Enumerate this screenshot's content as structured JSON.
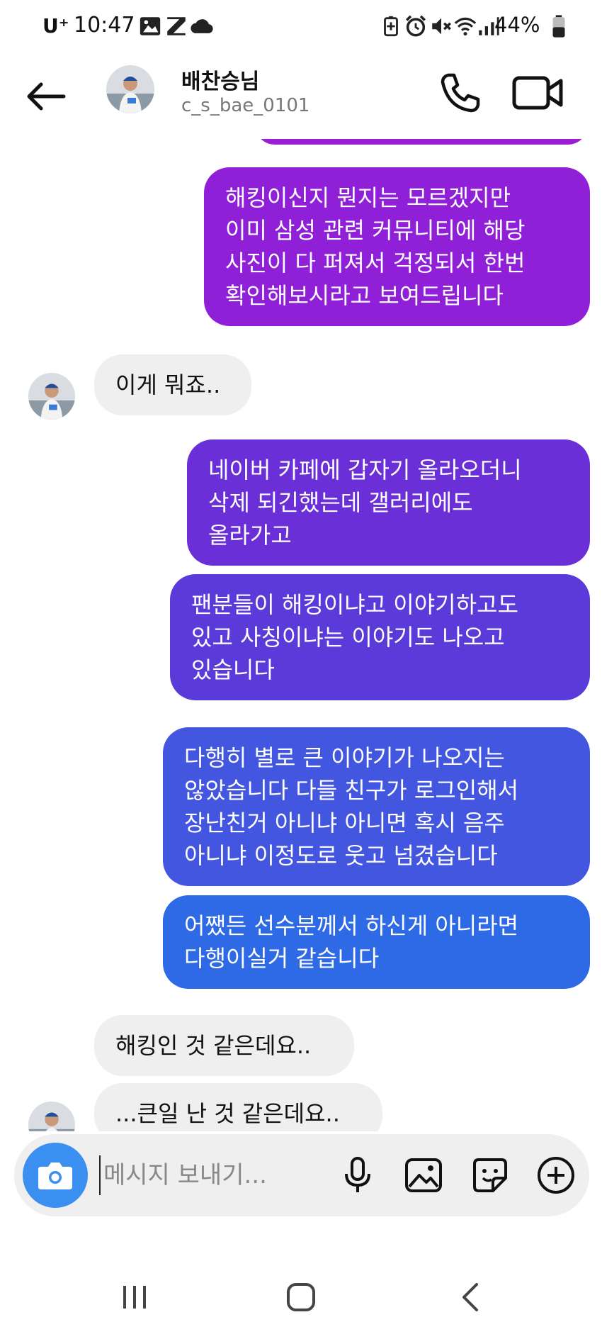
{
  "status_bar": {
    "carrier": "U⁺",
    "time": "10:47",
    "battery": "44%",
    "left_icons": [
      "gallery-icon",
      "z-app-icon",
      "cloud-icon"
    ],
    "right_icons": [
      "battery-saver-icon",
      "alarm-icon",
      "mute-icon",
      "wifi-icon",
      "signal-icon",
      "battery-icon"
    ]
  },
  "header": {
    "name": "배찬승님",
    "username": "c_s_bae_0101"
  },
  "messages": [
    {
      "direction": "out",
      "text": "해킹이신지 뭔지는 모르겠지만\n이미 삼성 관련 커뮤니티에 해당\n사진이 다 퍼져서 걱정되서 한번\n확인해보시라고 보여드립니다",
      "color": "#8f20d8"
    },
    {
      "direction": "in",
      "text": "이게 뭐죠.."
    },
    {
      "direction": "out",
      "text": "네이버 카페에 갑자기 올라오더니\n삭제 되긴했는데 갤러리에도\n올라가고",
      "color": "#6a2fd6"
    },
    {
      "direction": "out",
      "text": "팬분들이 해킹이냐고 이야기하고도\n있고 사칭이냐는 이야기도 나오고\n있습니다",
      "color": "#5a3ad8"
    },
    {
      "direction": "out",
      "text": "다행히 별로 큰 이야기가 나오지는\n않았습니다 다들 친구가 로그인해서\n장난친거 아니냐 아니면 혹시 음주\n아니냐 이정도로 웃고 넘겼습니다",
      "color": "#4356e0"
    },
    {
      "direction": "out",
      "text": "어쨌든 선수분께서 하신게 아니라면\n다행이실거 같습니다",
      "color": "#2e6ae6"
    },
    {
      "direction": "in",
      "text": "해킹인 것 같은데요.."
    },
    {
      "direction": "in",
      "text": "...큰일 난 것 같은데요.."
    }
  ],
  "composer": {
    "placeholder": "메시지 보내기...",
    "icons": [
      "camera-icon",
      "microphone-icon",
      "gallery-icon",
      "sticker-icon",
      "add-icon"
    ]
  },
  "navbar": {
    "icons": [
      "recent-apps-icon",
      "home-icon",
      "back-icon"
    ]
  },
  "colors": {
    "incoming_bubble": "#efefef",
    "camera_button": "#3b8ff0",
    "gradient_top": "#9b1fd4",
    "gradient_bottom": "#2b6de6"
  }
}
